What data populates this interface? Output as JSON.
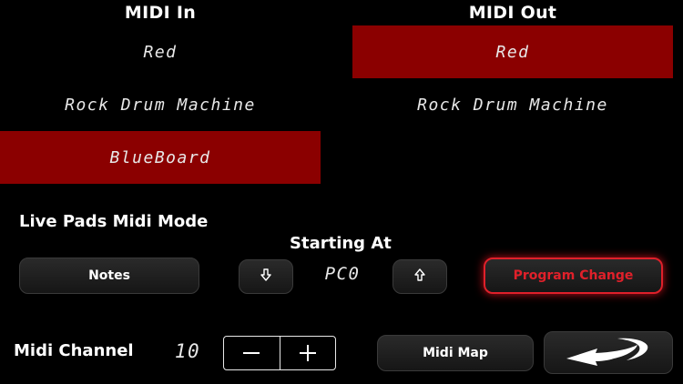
{
  "midi_in": {
    "title": "MIDI In",
    "devices": [
      {
        "label": "Red",
        "selected": false
      },
      {
        "label": "Rock Drum Machine",
        "selected": false
      },
      {
        "label": "BlueBoard",
        "selected": true
      }
    ]
  },
  "midi_out": {
    "title": "MIDI Out",
    "devices": [
      {
        "label": "Red",
        "selected": true
      },
      {
        "label": "Rock Drum Machine",
        "selected": false
      }
    ]
  },
  "live_pads": {
    "title": "Live Pads Midi Mode",
    "notes_label": "Notes",
    "starting_at_label": "Starting At",
    "value": "PC0",
    "program_change_label": "Program Change",
    "active_mode": "Program Change"
  },
  "channel": {
    "label": "Midi Channel",
    "value": "10"
  },
  "midi_map_label": "Midi Map",
  "colors": {
    "selected_row": "#8b0000",
    "accent": "#e0202a",
    "background": "#000000"
  },
  "icons": {
    "down": "arrow-down-icon",
    "up": "arrow-up-icon",
    "minus": "minus-icon",
    "plus": "plus-icon",
    "back": "back-arrow-icon"
  }
}
